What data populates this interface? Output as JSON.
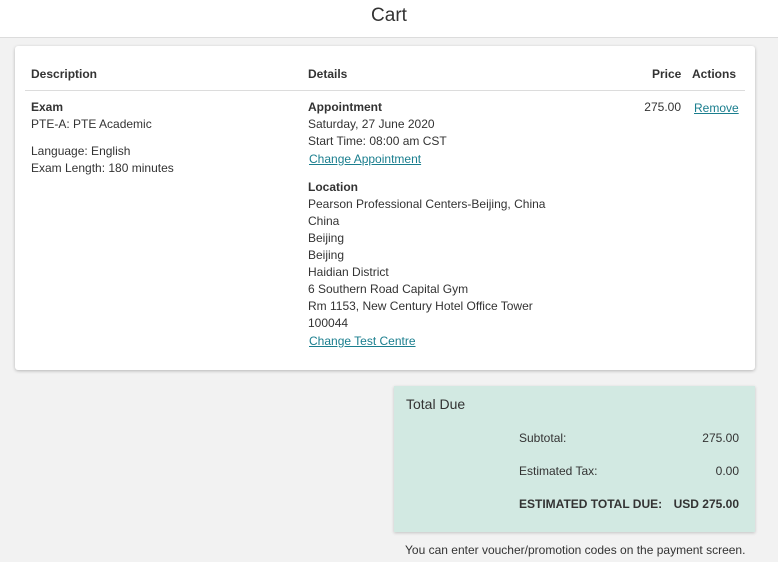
{
  "header": {
    "title": "Cart"
  },
  "cart": {
    "columns": {
      "description": "Description",
      "details": "Details",
      "price": "Price",
      "actions": "Actions"
    },
    "item": {
      "exam_label": "Exam",
      "exam_name": "PTE-A: PTE Academic",
      "language": "Language: English",
      "length": "Exam Length: 180 minutes",
      "appointment_label": "Appointment",
      "appointment_date": "Saturday, 27 June 2020",
      "start_time": "Start Time: 08:00 am CST",
      "change_appointment": "Change Appointment",
      "location_label": "Location",
      "location_lines": [
        "Pearson Professional Centers-Beijing, China",
        "China",
        "Beijing",
        "Beijing",
        "Haidian District",
        "6 Southern Road Capital Gym",
        "Rm 1153, New Century Hotel Office Tower",
        "100044"
      ],
      "change_test_centre": "Change Test Centre",
      "price": "275.00",
      "remove": "Remove"
    }
  },
  "totals": {
    "title": "Total Due",
    "subtotal_label": "Subtotal:",
    "subtotal_value": "275.00",
    "tax_label": "Estimated Tax:",
    "tax_value": "0.00",
    "total_label": "ESTIMATED TOTAL DUE:",
    "total_value": "USD 275.00"
  },
  "footnote": "You can enter voucher/promotion codes on the payment screen.",
  "colors": {
    "link": "#1a7e8e",
    "total_box_bg": "#d2e9e2",
    "page_bg": "#f2f2f2"
  }
}
